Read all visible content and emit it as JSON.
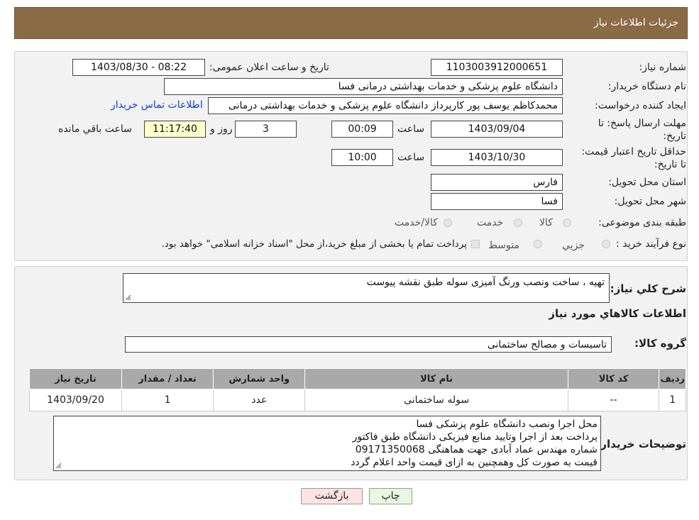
{
  "header": {
    "title": "جزئیات اطلاعات نیاز"
  },
  "form": {
    "need_number_label": "شماره نیاز:",
    "need_number": "1103003912000651",
    "announce_label": "تاریخ و ساعت اعلان عمومی:",
    "announce_value": "1403/08/30 - 08:22",
    "buyer_org_label": "نام دستگاه خریدار:",
    "buyer_org": "دانشگاه علوم پزشکی و خدمات بهداشتی درمانی فسا",
    "creator_label": "ایجاد کننده درخواست:",
    "creator": "محمدکاظم یوسف پور کارپرداز دانشگاه علوم پزشکی و خدمات بهداشتی درمانی",
    "contact_link": "اطلاعات تماس خریدار",
    "deadline_label": "مهلت ارسال پاسخ: تا تاریخ:",
    "deadline_date": "1403/09/04",
    "time_word": "ساعت",
    "deadline_time": "00:09",
    "days_value": "3",
    "days_word": "روز و",
    "remaining_time": "11:17:40",
    "remaining_word": "ساعت باقي مانده",
    "validity_label": "حداقل تاریخ اعتبار قیمت: تا تاریخ:",
    "validity_date": "1403/10/30",
    "validity_time": "10:00",
    "province_label": "استان محل تحویل:",
    "province": "فارس",
    "city_label": "شهر محل تحویل:",
    "city": "فسا",
    "category_label": "طبقه بندی موضوعی:",
    "category_options": [
      "کالا",
      "خدمت",
      "کالا/خدمت"
    ],
    "process_label": "نوع فرآیند خرید :",
    "process_options": [
      "جزیي",
      "متوسط"
    ],
    "process_note": "پرداخت تمام یا بخشی از مبلغ خرید،از محل \"اسناد خزانه اسلامی\" خواهد بود."
  },
  "description": {
    "label": "شرح کلي نياز:",
    "text": "تهیه ، ساخت ونصب ورنگ آمیزی سوله طبق نقشه پیوست",
    "goods_info_title": "اطلاعات کالاهاي مورد نياز",
    "group_label": "گروه کالا:",
    "group_value": "تاسیسات و مصالح ساختمانی"
  },
  "table": {
    "headers": [
      "رديف",
      "کد کالا",
      "نام کالا",
      "واحد شمارش",
      "تعداد / مقدار",
      "تاریخ نیاز"
    ],
    "rows": [
      [
        "1",
        "--",
        "سوله ساختمانی",
        "عدد",
        "1",
        "1403/09/20"
      ]
    ]
  },
  "buyer_notes": {
    "label": "توضیحات خریدار:",
    "lines": [
      "محل اجرا ونصب دانشگاه علوم پزشکی فسا",
      "پرداخت بعد از اجرا وتایید منابع فیزیکی دانشگاه طبق فاکتور",
      "شماره مهندس عماد آبادی جهت هماهنگی 09171350068",
      "قیمت به صورت کل وهمچنین به ازای قیمت واحد اعلام گردد"
    ]
  },
  "buttons": {
    "back": "بازگشت",
    "print": "چاپ"
  },
  "colors": {
    "header_bg": "#8b6b46",
    "highlight": "#ffffcc",
    "back_button": "#fde3e3",
    "print_button": "#e8f7e0",
    "link": "#0b3fd0"
  }
}
